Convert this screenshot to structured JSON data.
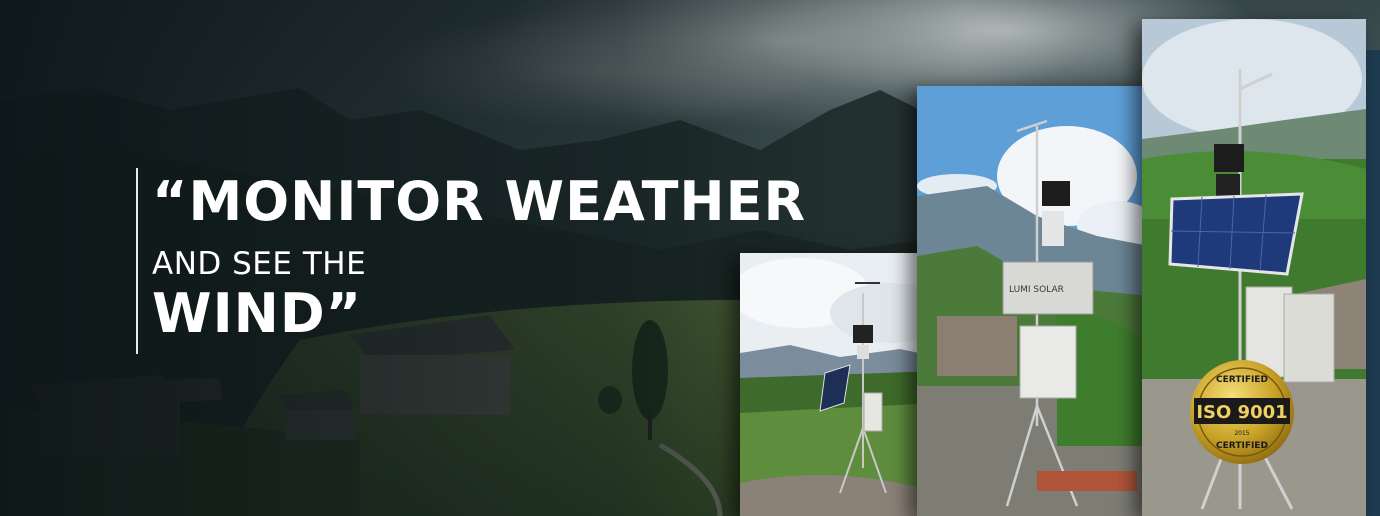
{
  "headline": {
    "line1": "“MONITOR WEATHER",
    "line2": "AND SEE THE",
    "line3": "WIND”"
  },
  "badge": {
    "top": "CERTIFIED",
    "main": "ISO 9001",
    "year": "2015",
    "bottom": "CERTIFIED"
  },
  "panel_text": "LUMI SOLAR",
  "colors": {
    "headline": "#ffffff",
    "badge_gold": "#c9a227",
    "badge_dark": "#1a1a1a"
  }
}
